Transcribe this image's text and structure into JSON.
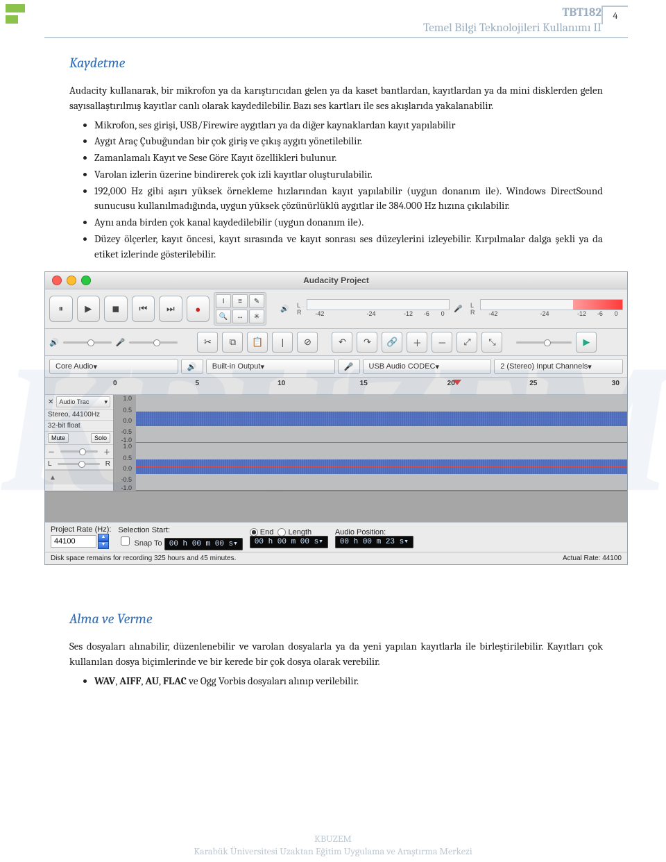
{
  "header": {
    "code": "TBT182",
    "title": "Temel Bilgi Teknolojileri Kullanımı II",
    "pagenum": "4"
  },
  "watermark": "KBUZEM",
  "h1": "Kaydetme",
  "p1": "Audacity kullanarak, bir mikrofon ya da karıştırıcıdan gelen ya da kaset bantlardan, kayıtlardan ya da mini disklerden gelen sayısallaştırılmış kayıtlar canlı olarak kaydedilebilir. Bazı ses kartları ile ses akışlarıda yakalanabilir.",
  "b1": [
    "Mikrofon, ses girişi, USB/Firewire aygıtları ya da diğer kaynaklardan kayıt yapılabilir",
    "Aygıt Araç Çubuğundan bir çok giriş ve çıkış aygıtı yönetilebilir.",
    "Zamanlamalı Kayıt ve Sese Göre Kayıt özellikleri bulunur.",
    "Varolan izlerin üzerine bindirerek çok izli kayıtlar oluşturulabilir.",
    "192,000 Hz gibi aşırı yüksek örnekleme hızlarından kayıt yapılabilir (uygun donanım ile). Windows DirectSound sunucusu kullanılmadığında, uygun yüksek çözünürlüklü aygıtlar ile 384.000 Hz hızına çıkılabilir.",
    "Aynı anda birden çok kanal kaydedilebilir (uygun donanım ile).",
    "Düzey ölçerler, kayıt öncesi, kayıt sırasında ve kayıt sonrası ses düzeylerini izleyebilir. Kırpılmalar dalga şekli ya da etiket izlerinde gösterilebilir."
  ],
  "h2": "Alma ve Verme",
  "p2": "Ses dosyaları alınabilir, düzenlenebilir ve varolan dosyalarla ya da yeni yapılan kayıtlarla ile birleştirilebilir. Kayıtları çok kullanılan dosya biçimlerinde ve bir kerede bir çok dosya olarak verebilir.",
  "b2a": "WAV",
  "b2b": "AIFF",
  "b2c": "AU",
  "b2d": "FLAC",
  "b2e": " ve Ogg Vorbis dosyaları alınıp verilebilir.",
  "footer": {
    "l1": "KBUZEM",
    "l2": "Karabük Üniversitesi Uzaktan Eğitim Uygulama ve Araştırma Merkezi"
  },
  "app": {
    "title": "Audacity Project",
    "host": "Core Audio",
    "output": "Built-in Output",
    "input": "USB Audio CODEC",
    "channels": "2 (Stereo) Input Channels",
    "ticks": [
      "-42",
      "-24",
      "-12",
      "-6",
      "0"
    ],
    "ruler": [
      "0",
      "5",
      "10",
      "15",
      "20",
      "25",
      "30"
    ],
    "track": {
      "name": "Audio Trac",
      "fmt1": "Stereo, 44100Hz",
      "fmt2": "32-bit float",
      "mute": "Mute",
      "solo": "Solo"
    },
    "yt": [
      "1.0",
      "0.5",
      "0.0",
      "-0.5",
      "-1.0"
    ],
    "bottom": {
      "rate_lbl": "Project Rate (Hz):",
      "rate": "44100",
      "sel_lbl": "Selection Start:",
      "end": "End",
      "len": "Length",
      "pos_lbl": "Audio Position:",
      "snap": "Snap To",
      "t1": "00 h 00 m 00 s",
      "t2": "00 h 00 m 00 s",
      "t3": "00 h 00 m 23 s"
    },
    "status": {
      "left": "Disk space remains for recording 325 hours and 45 minutes.",
      "right": "Actual Rate: 44100"
    }
  }
}
